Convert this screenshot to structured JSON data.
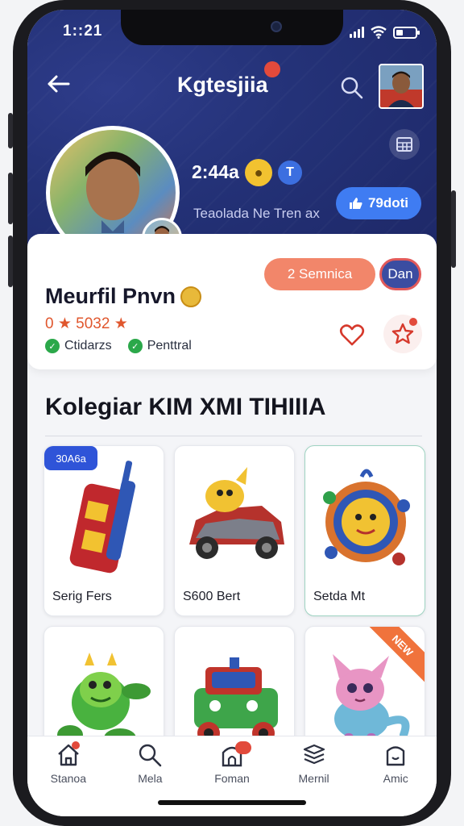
{
  "status_bar": {
    "time": "1::21"
  },
  "header": {
    "title": "Kgtesjiia",
    "title_badge": "",
    "back_icon": "arrow-left-icon",
    "search_icon": "search-icon",
    "grid_icon": "grid-icon"
  },
  "profile": {
    "stat_value": "2:44a",
    "tagline": "Teaolada Ne Tren ax",
    "follow_label": "79doti",
    "primary_button": "2 Semnica",
    "secondary_button": "Dan",
    "name": "Meurfil Pnvn",
    "rating": "0 ★ 5032 ★",
    "tags": [
      {
        "label": "Ctidarzs"
      },
      {
        "label": "Penttral"
      }
    ]
  },
  "collection": {
    "title": "Kolegiar KIM XMI TIHIIIA",
    "items": [
      {
        "label": "Serig Fers",
        "badge": "30A6a",
        "art": "suitcase"
      },
      {
        "label": "S600 Bert",
        "badge": "",
        "art": "car"
      },
      {
        "label": "Setda Mt",
        "badge": "",
        "art": "medal"
      },
      {
        "label": "",
        "badge": "",
        "art": "dragon"
      },
      {
        "label": "",
        "badge": "",
        "art": "jeep"
      },
      {
        "label": "",
        "badge": "NEW",
        "art": "cat"
      }
    ]
  },
  "bottom_nav": [
    {
      "label": "Stanoa",
      "icon": "home-icon"
    },
    {
      "label": "Mela",
      "icon": "search-icon"
    },
    {
      "label": "Foman",
      "icon": "profile-icon"
    },
    {
      "label": "Mernil",
      "icon": "stack-icon"
    },
    {
      "label": "Amic",
      "icon": "account-icon"
    }
  ],
  "colors": {
    "header_bg": "#243278",
    "accent_blue": "#3f7cf2",
    "accent_orange": "#f2866a",
    "accent_red": "#e24a3b"
  }
}
